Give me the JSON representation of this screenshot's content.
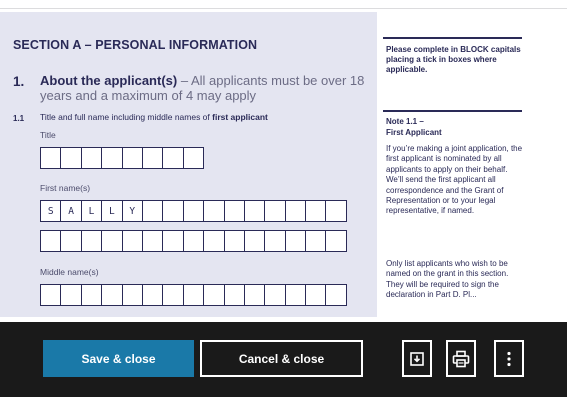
{
  "form": {
    "section_title": "SECTION A – PERSONAL INFORMATION",
    "question_number": "1.",
    "question_title": "About the applicant(s)",
    "question_text": " – All applicants must be over 18 years and a maximum of 4 may apply",
    "sub_number": "1.1",
    "sub_text_prefix": "Title and full name including middle names of ",
    "sub_text_bold": "first applicant",
    "title_label": "Title",
    "first_name_label": "First name(s)",
    "first_name_letters": [
      "S",
      "A",
      "L",
      "L",
      "Y"
    ],
    "middle_name_label": "Middle name(s)"
  },
  "sidebar": {
    "instruction": "Please complete in BLOCK capitals placing a tick in boxes where applicable.",
    "note_title": "Note 1.1 –",
    "note_subtitle": "First Applicant",
    "note_para1": "If you’re making a joint application, the first applicant is nominated by all applicants to apply on their behalf. We’ll send the first applicant all correspondence and the Grant of Representation or to your legal representative, if named.",
    "note_para2": "Only list applicants who wish to be named on the grant in this section. They will be required to sign the declaration in Part D. Pl..."
  },
  "toolbar": {
    "save_label": "Save & close",
    "cancel_label": "Cancel & close",
    "download_icon": "download-icon",
    "print_icon": "print-icon",
    "more_icon": "more-vertical-icon"
  },
  "colors": {
    "navy": "#2a2a57",
    "form_bg": "#e4e5f1",
    "bar_bg": "#1a1a1a",
    "save_bg": "#1a79a8"
  }
}
